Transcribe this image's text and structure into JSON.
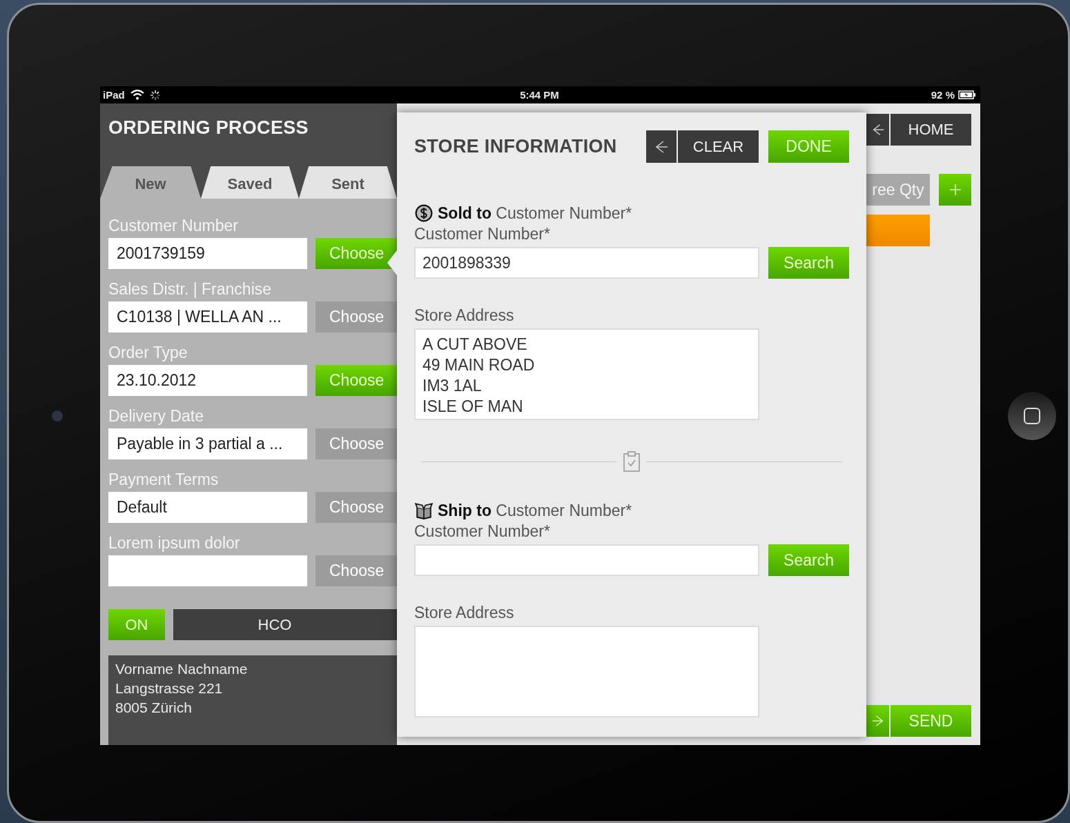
{
  "status_bar": {
    "carrier": "iPad",
    "time": "5:44 PM",
    "battery": "92 %"
  },
  "panel": {
    "title": "ORDERING PROCESS",
    "tabs": [
      {
        "label": "New",
        "selected": true
      },
      {
        "label": "Saved",
        "selected": false
      },
      {
        "label": "Sent",
        "selected": false
      }
    ],
    "fields": [
      {
        "label": "Customer Number",
        "value": "2001739159",
        "button": "Choose",
        "disabled": false
      },
      {
        "label": "Sales Distr. | Franchise",
        "value": "C10138 | WELLA AN ...",
        "button": "Choose",
        "disabled": true
      },
      {
        "label": "Order Type",
        "value": "23.10.2012",
        "button": "Choose",
        "disabled": false
      },
      {
        "label": "Delivery Date",
        "value": "Payable in 3 partial a ...",
        "button": "Choose",
        "disabled": true
      },
      {
        "label": "Payment Terms",
        "value": "Default",
        "button": "Choose",
        "disabled": true
      },
      {
        "label": "Lorem ipsum dolor",
        "button": "Choose",
        "disabled": true
      }
    ],
    "toggle": {
      "label": "ON",
      "on": true
    },
    "group": "HCO",
    "address_lines": [
      "Vorname Nachname",
      "Langstrasse 221",
      "8005 Zürich"
    ]
  },
  "background": {
    "home": "HOME",
    "free_qty": "ree Qty",
    "send": "SEND"
  },
  "dialog": {
    "title": "STORE INFORMATION",
    "clear": "CLEAR",
    "done": "DONE",
    "sections": [
      {
        "kind": "sold",
        "heading": "**Sold to** Customer Number*",
        "label": "Customer Number*",
        "value": "2001898339",
        "button": "Search",
        "address_label": "Store Address",
        "address_lines": [
          "A CUT ABOVE",
          "49 MAIN ROAD",
          "IM3 1AL",
          "ISLE OF MAN"
        ]
      },
      {
        "kind": "ship",
        "heading": "**Ship to** Customer Number*",
        "label": "Customer Number*",
        "button": "Search",
        "address_label": "Store Address"
      }
    ]
  }
}
